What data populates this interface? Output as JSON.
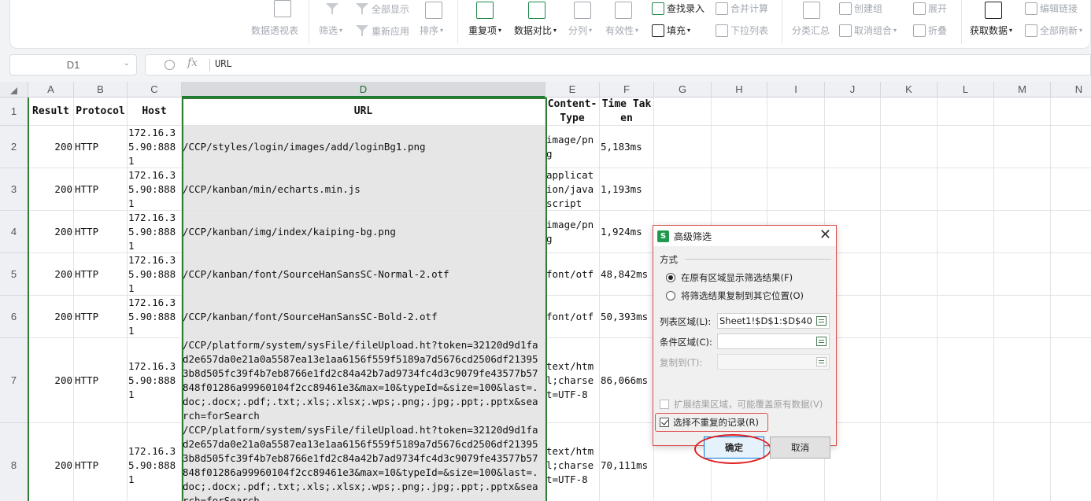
{
  "ribbon": {
    "pivot": "数据透视表",
    "filter": "筛选",
    "show_all": "全部显示",
    "reapply": "重新应用",
    "sort": "排序",
    "duplicates": "重复项",
    "compare": "数据对比",
    "split": "分列",
    "validity": "有效性",
    "find_entry": "查找录入",
    "fill": "填充",
    "consolidate": "合并计算",
    "dropdown_list": "下拉列表",
    "subtotal": "分类汇总",
    "group": "创建组",
    "ungroup": "取消组合",
    "expand": "展开",
    "collapse": "折叠",
    "get_data": "获取数据",
    "edit_links": "编辑链接",
    "refresh_all": "全部刷新"
  },
  "formula": {
    "name_box": "D1",
    "fx": "fx",
    "value": "URL"
  },
  "columns": [
    "A",
    "B",
    "C",
    "D",
    "E",
    "F",
    "G",
    "H",
    "I",
    "J",
    "K",
    "L",
    "M",
    "N"
  ],
  "rows": [
    "1",
    "2",
    "3",
    "4",
    "5",
    "6",
    "7",
    "8"
  ],
  "sheet": {
    "header": {
      "a": "Result",
      "b": "Protocol",
      "c": "Host",
      "d": "URL",
      "e": "Content-Type",
      "f": "Time Taken"
    },
    "data": [
      {
        "a": "200",
        "b": "HTTP",
        "c": "172.16.35.90:8881",
        "d": "/CCP/styles/login/images/add/loginBg1.png",
        "e": "image/png",
        "f": "5,183ms"
      },
      {
        "a": "200",
        "b": "HTTP",
        "c": "172.16.35.90:8881",
        "d": "/CCP/kanban/min/echarts.min.js",
        "e": "application/javascript",
        "f": "1,193ms"
      },
      {
        "a": "200",
        "b": "HTTP",
        "c": "172.16.35.90:8881",
        "d": "/CCP/kanban/img/index/kaiping-bg.png",
        "e": "image/png",
        "f": "1,924ms"
      },
      {
        "a": "200",
        "b": "HTTP",
        "c": "172.16.35.90:8881",
        "d": "/CCP/kanban/font/SourceHanSansSC-Normal-2.otf",
        "e": "font/otf",
        "f": "48,842ms"
      },
      {
        "a": "200",
        "b": "HTTP",
        "c": "172.16.35.90:8881",
        "d": "/CCP/kanban/font/SourceHanSansSC-Bold-2.otf",
        "e": "font/otf",
        "f": "50,393ms"
      },
      {
        "a": "200",
        "b": "HTTP",
        "c": "172.16.35.90:8881",
        "d": "/CCP/platform/system/sysFile/fileUpload.ht?token=32120d9d1fad2e657da0e21a0a5587ea13e1aa6156f559f5189a7d5676cd2506df213953b8d505fc39f4b7eb8766e1fd2c84a42b7ad9734fc4d3c9079fe43577b57848f01286a99960104f2cc89461e3&max=10&typeId=&size=100&last=.doc;.docx;.pdf;.txt;.xls;.xlsx;.wps;.png;.jpg;.ppt;.pptx&search=forSearch",
        "e": "text/html;charset=UTF-8",
        "f": "86,066ms"
      },
      {
        "a": "200",
        "b": "HTTP",
        "c": "172.16.35.90:8881",
        "d": "/CCP/platform/system/sysFile/fileUpload.ht?token=32120d9d1fad2e657da0e21a0a5587ea13e1aa6156f559f5189a7d5676cd2506df213953b8d505fc39f4b7eb8766e1fd2c84a42b7ad9734fc4d3c9079fe43577b57848f01286a99960104f2cc89461e3&max=10&typeId=&size=100&last=.doc;.docx;.pdf;.txt;.xls;.xlsx;.wps;.png;.jpg;.ppt;.pptx&search=forSearch",
        "e": "text/html;charset=UTF-8",
        "f": "70,111ms"
      }
    ]
  },
  "dialog": {
    "logo": "S",
    "title": "高级筛选",
    "close": "✕",
    "mode_label": "方式",
    "option_inplace": "在原有区域显示筛选结果(F)",
    "option_copy": "将筛选结果复制到其它位置(O)",
    "list_range_label": "列表区域(L):",
    "list_range_value": "Sheet1!$D$1:$D$40",
    "criteria_label": "条件区域(C):",
    "criteria_value": "",
    "copy_to_label": "复制到(T):",
    "copy_to_value": "",
    "expand_label": "扩展结果区域，可能覆盖原有数据(V)",
    "unique_label": "选择不重复的记录(R)",
    "ok": "确定",
    "cancel": "取消"
  }
}
